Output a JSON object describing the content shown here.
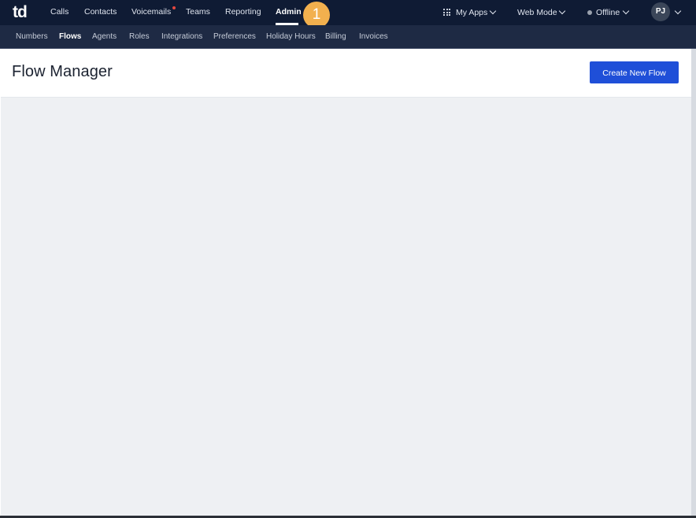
{
  "topnav": {
    "logo": "td",
    "items": [
      "Calls",
      "Contacts",
      "Voicemails",
      "Teams",
      "Reporting",
      "Admin"
    ],
    "active": "Admin",
    "step_badge": "1",
    "my_apps_label": "My Apps",
    "web_mode_label": "Web Mode",
    "status_label": "Offline",
    "avatar_initials": "PJ"
  },
  "subnav": {
    "items": [
      "Numbers",
      "Flows",
      "Agents",
      "Roles",
      "Integrations",
      "Preferences",
      "Holiday Hours",
      "Billing",
      "Invoices"
    ],
    "active": "Flows"
  },
  "page": {
    "title": "Flow Manager",
    "create_button_label": "Create New Flow"
  },
  "colors": {
    "topbar": "#0f1b34",
    "subnav": "#1e2a44",
    "accent_button": "#1f4fd8",
    "badge": "#f2b04e",
    "notification_dot": "#e5483f",
    "content_bg": "#eef0f3"
  }
}
